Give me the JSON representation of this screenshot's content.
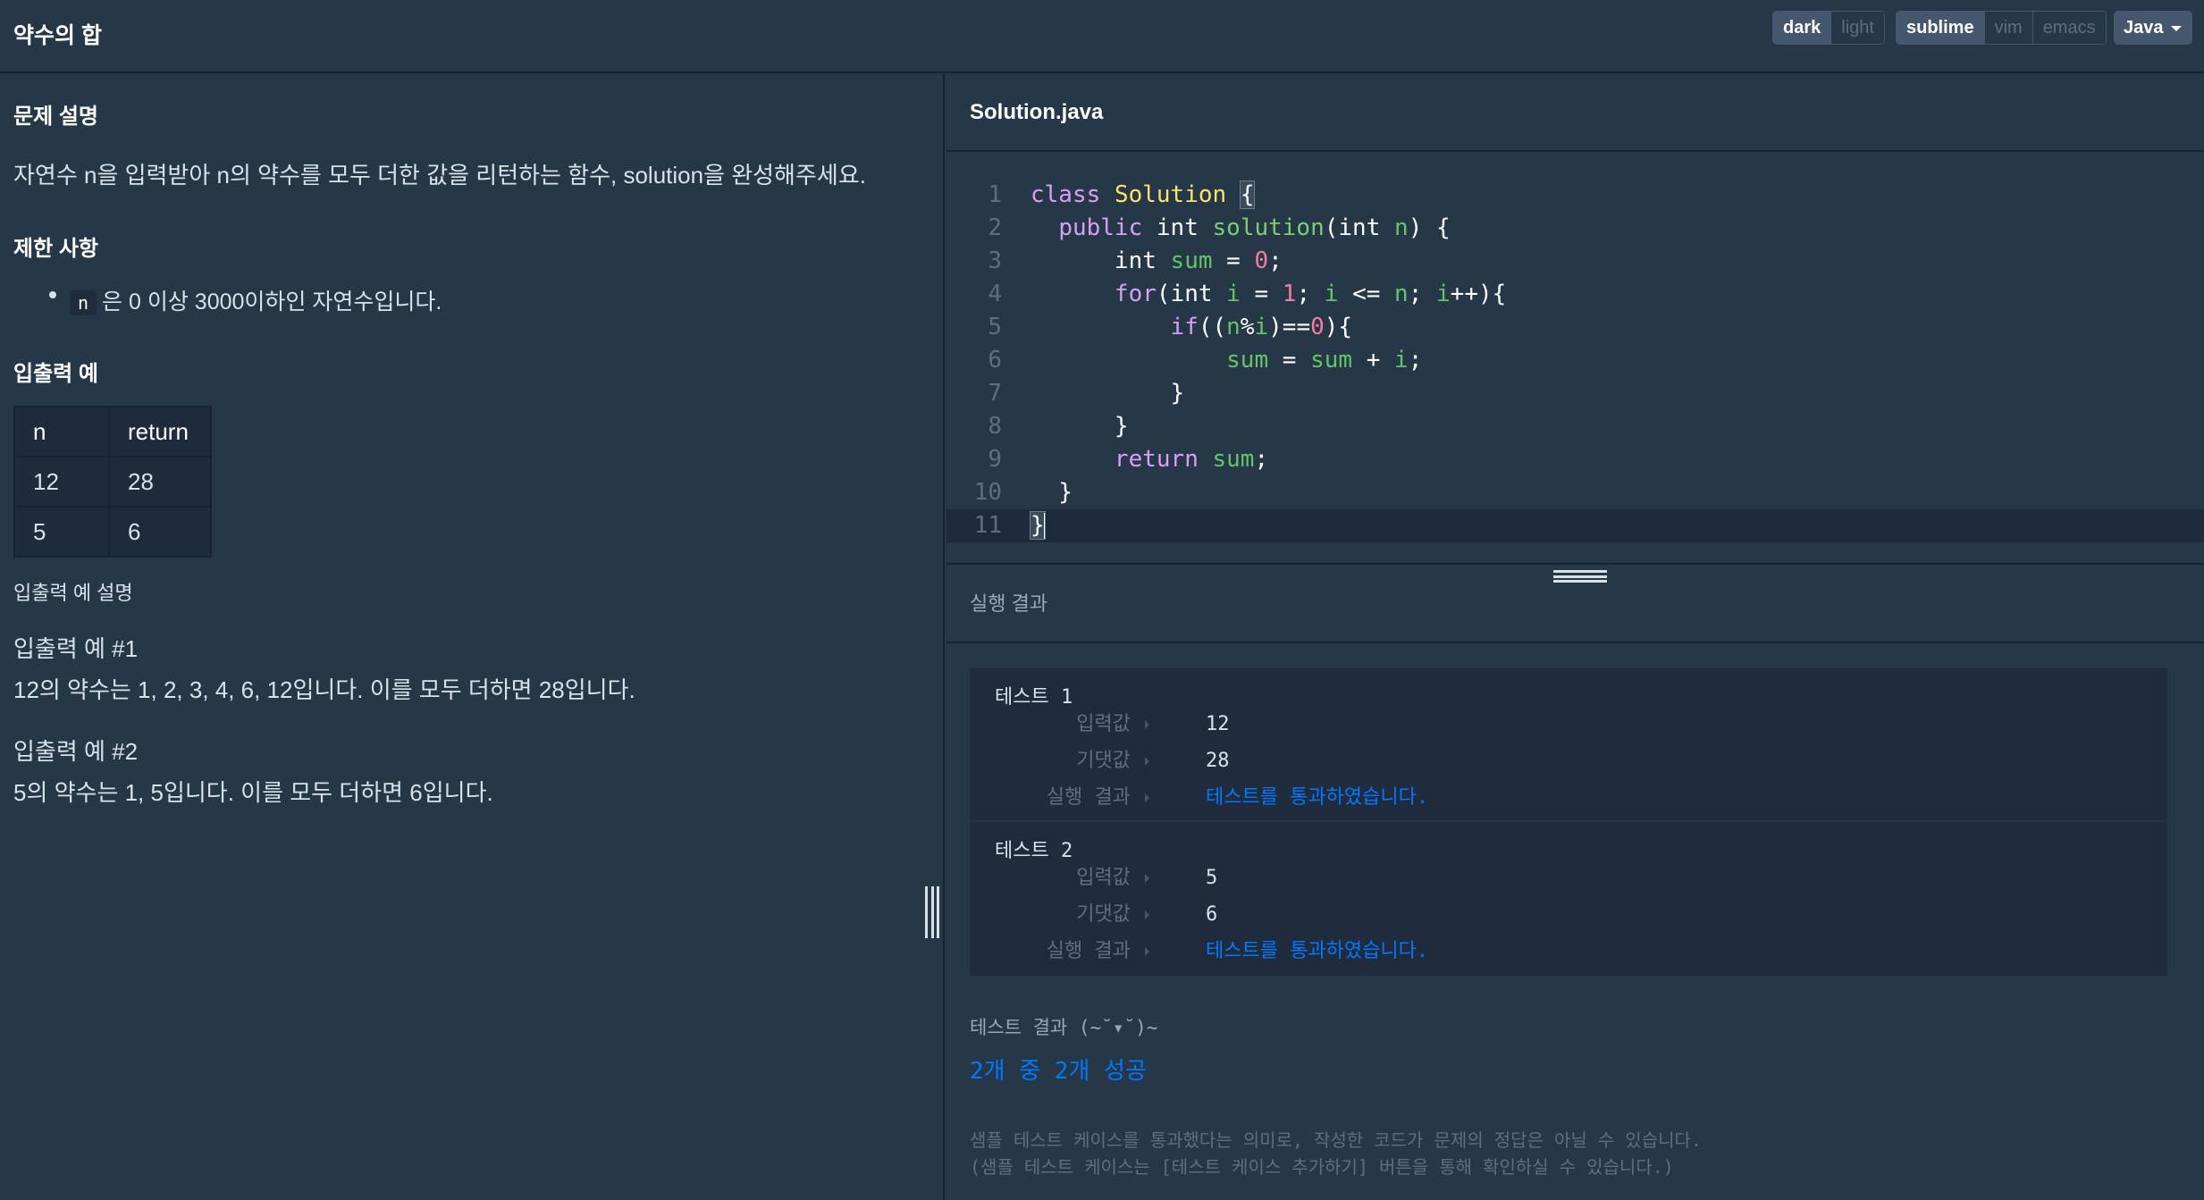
{
  "header": {
    "title": "약수의 합",
    "theme_options": [
      "dark",
      "light"
    ],
    "theme_selected": "dark",
    "keymap_options": [
      "sublime",
      "vim",
      "emacs"
    ],
    "keymap_selected": "sublime",
    "language": "Java"
  },
  "problem": {
    "section_description": "문제 설명",
    "description": "자연수 n을 입력받아 n의 약수를 모두 더한 값을 리턴하는 함수, solution을 완성해주세요.",
    "section_constraints": "제한 사항",
    "constraint_code": "n",
    "constraint_text": "은 0 이상 3000이하인 자연수입니다.",
    "section_examples": "입출력 예",
    "table": {
      "headers": [
        "n",
        "return"
      ],
      "rows": [
        [
          "12",
          "28"
        ],
        [
          "5",
          "6"
        ]
      ]
    },
    "examples_explanation_title": "입출력 예 설명",
    "example1_title": "입출력 예 #1",
    "example1_text": "12의 약수는 1, 2, 3, 4, 6, 12입니다. 이를 모두 더하면 28입니다.",
    "example2_title": "입출력 예 #2",
    "example2_text": "5의 약수는 1, 5입니다. 이를 모두 더하면 6입니다."
  },
  "editor": {
    "filename": "Solution.java",
    "line_numbers": [
      "1",
      "2",
      "3",
      "4",
      "5",
      "6",
      "7",
      "8",
      "9",
      "10",
      "11"
    ],
    "active_line": 11
  },
  "run": {
    "title": "실행 결과",
    "tests": [
      {
        "name": "테스트 1",
        "input_label": "입력값",
        "input": "12",
        "expected_label": "기댓값",
        "expected": "28",
        "result_label": "실행 결과",
        "result": "테스트를 통과하였습니다."
      },
      {
        "name": "테스트 2",
        "input_label": "입력값",
        "input": "5",
        "expected_label": "기댓값",
        "expected": "6",
        "result_label": "실행 결과",
        "result": "테스트를 통과하였습니다."
      }
    ],
    "summary_title": "테스트 결과 (~˘▾˘)~",
    "summary_result": "2개 중 2개 성공",
    "note_line1": "샘플 테스트 케이스를 통과했다는 의미로, 작성한 코드가 문제의 정답은 아닐 수 있습니다.",
    "note_line2": "(샘플 테스트 케이스는 [테스트 케이스 추가하기] 버튼을 통해 확인하실 수 있습니다.)"
  }
}
